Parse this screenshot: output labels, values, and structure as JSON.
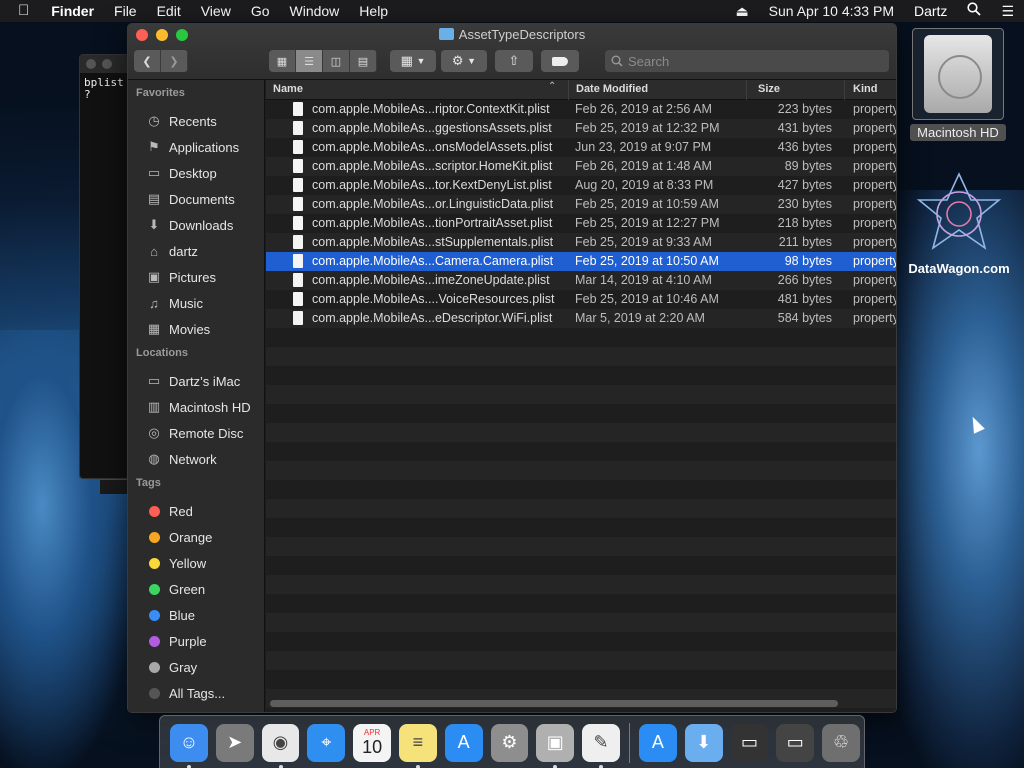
{
  "menubar": {
    "app": "Finder",
    "menus": [
      "File",
      "Edit",
      "View",
      "Go",
      "Window",
      "Help"
    ],
    "clock": "Sun Apr 10  4:33 PM",
    "user": "Dartz"
  },
  "terminal": {
    "text": "bplist\n?"
  },
  "window": {
    "title": "AssetTypeDescriptors",
    "search_placeholder": "Search"
  },
  "sidebar": {
    "favorites_header": "Favorites",
    "favorites": [
      {
        "label": "Recents",
        "icon": "clock-icon"
      },
      {
        "label": "Applications",
        "icon": "applications-icon"
      },
      {
        "label": "Desktop",
        "icon": "desktop-icon"
      },
      {
        "label": "Documents",
        "icon": "document-icon"
      },
      {
        "label": "Downloads",
        "icon": "download-icon"
      },
      {
        "label": "dartz",
        "icon": "home-icon"
      },
      {
        "label": "Pictures",
        "icon": "camera-icon"
      },
      {
        "label": "Music",
        "icon": "music-icon"
      },
      {
        "label": "Movies",
        "icon": "film-icon"
      }
    ],
    "locations_header": "Locations",
    "locations": [
      {
        "label": "Dartz’s iMac",
        "icon": "imac-icon"
      },
      {
        "label": "Macintosh HD",
        "icon": "hard-drive-icon"
      },
      {
        "label": "Remote Disc",
        "icon": "disc-icon"
      },
      {
        "label": "Network",
        "icon": "globe-icon"
      }
    ],
    "tags_header": "Tags",
    "tags": [
      {
        "label": "Red",
        "color": "#fc5f57"
      },
      {
        "label": "Orange",
        "color": "#f5a623"
      },
      {
        "label": "Yellow",
        "color": "#f8d83a"
      },
      {
        "label": "Green",
        "color": "#3dd461"
      },
      {
        "label": "Blue",
        "color": "#3a8df5"
      },
      {
        "label": "Purple",
        "color": "#b25de0"
      },
      {
        "label": "Gray",
        "color": "#a8a8a8"
      }
    ],
    "all_tags": "All Tags..."
  },
  "columns": {
    "name": "Name",
    "date": "Date Modified",
    "size": "Size",
    "kind": "Kind"
  },
  "files": [
    {
      "name": "com.apple.MobileAs...riptor.ContextKit.plist",
      "date": "Feb 26, 2019 at 2:56 AM",
      "size": "223 bytes",
      "kind": "property"
    },
    {
      "name": "com.apple.MobileAs...ggestionsAssets.plist",
      "date": "Feb 25, 2019 at 12:32 PM",
      "size": "431 bytes",
      "kind": "property"
    },
    {
      "name": "com.apple.MobileAs...onsModelAssets.plist",
      "date": "Jun 23, 2019 at 9:07 PM",
      "size": "436 bytes",
      "kind": "property"
    },
    {
      "name": "com.apple.MobileAs...scriptor.HomeKit.plist",
      "date": "Feb 26, 2019 at 1:48 AM",
      "size": "89 bytes",
      "kind": "property"
    },
    {
      "name": "com.apple.MobileAs...tor.KextDenyList.plist",
      "date": "Aug 20, 2019 at 8:33 PM",
      "size": "427 bytes",
      "kind": "property"
    },
    {
      "name": "com.apple.MobileAs...or.LinguisticData.plist",
      "date": "Feb 25, 2019 at 10:59 AM",
      "size": "230 bytes",
      "kind": "property"
    },
    {
      "name": "com.apple.MobileAs...tionPortraitAsset.plist",
      "date": "Feb 25, 2019 at 12:27 PM",
      "size": "218 bytes",
      "kind": "property"
    },
    {
      "name": "com.apple.MobileAs...stSupplementals.plist",
      "date": "Feb 25, 2019 at 9:33 AM",
      "size": "211 bytes",
      "kind": "property"
    },
    {
      "name": "com.apple.MobileAs...Camera.Camera.plist",
      "date": "Feb 25, 2019 at 10:50 AM",
      "size": "98 bytes",
      "kind": "property",
      "selected": true
    },
    {
      "name": "com.apple.MobileAs...imeZoneUpdate.plist",
      "date": "Mar 14, 2019 at 4:10 AM",
      "size": "266 bytes",
      "kind": "property"
    },
    {
      "name": "com.apple.MobileAs....VoiceResources.plist",
      "date": "Feb 25, 2019 at 10:46 AM",
      "size": "481 bytes",
      "kind": "property"
    },
    {
      "name": "com.apple.MobileAs...eDescriptor.WiFi.plist",
      "date": "Mar 5, 2019 at 2:20 AM",
      "size": "584 bytes",
      "kind": "property"
    }
  ],
  "desktop": {
    "hd_label": "Macintosh HD",
    "datawagon_label": "DataWagon.com"
  },
  "calendar_icon": {
    "month": "APR",
    "day": "10"
  },
  "dock": [
    {
      "icon": "finder-icon",
      "color": "#3d8df0",
      "running": true
    },
    {
      "icon": "launchpad-icon",
      "color": "#7a7a7a",
      "running": false
    },
    {
      "icon": "chrome-icon",
      "color": "#e8e8e8",
      "running": true
    },
    {
      "icon": "safari-icon",
      "color": "#2f8ff0",
      "running": false
    },
    {
      "icon": "calendar-icon",
      "color": "#f4f4f4",
      "running": false
    },
    {
      "icon": "notes-icon",
      "color": "#f6e27a",
      "running": true
    },
    {
      "icon": "app-store-icon",
      "color": "#2b8cf3",
      "running": false
    },
    {
      "icon": "system-preferences-icon",
      "color": "#8e8e8e",
      "running": false
    },
    {
      "icon": "preview-icon",
      "color": "#b0b0b0",
      "running": true
    },
    {
      "icon": "textedit-icon",
      "color": "#efefef",
      "running": true
    },
    {
      "icon": "applications-folder-icon",
      "color": "#2b8cf3",
      "running": false
    },
    {
      "icon": "downloads-folder-icon",
      "color": "#6aaef0",
      "running": false
    },
    {
      "icon": "terminal-window-icon",
      "color": "#333333",
      "running": false
    },
    {
      "icon": "chrome-window-icon",
      "color": "#444444",
      "running": false
    },
    {
      "icon": "trash-icon",
      "color": "#6f6f6f",
      "running": false
    }
  ]
}
